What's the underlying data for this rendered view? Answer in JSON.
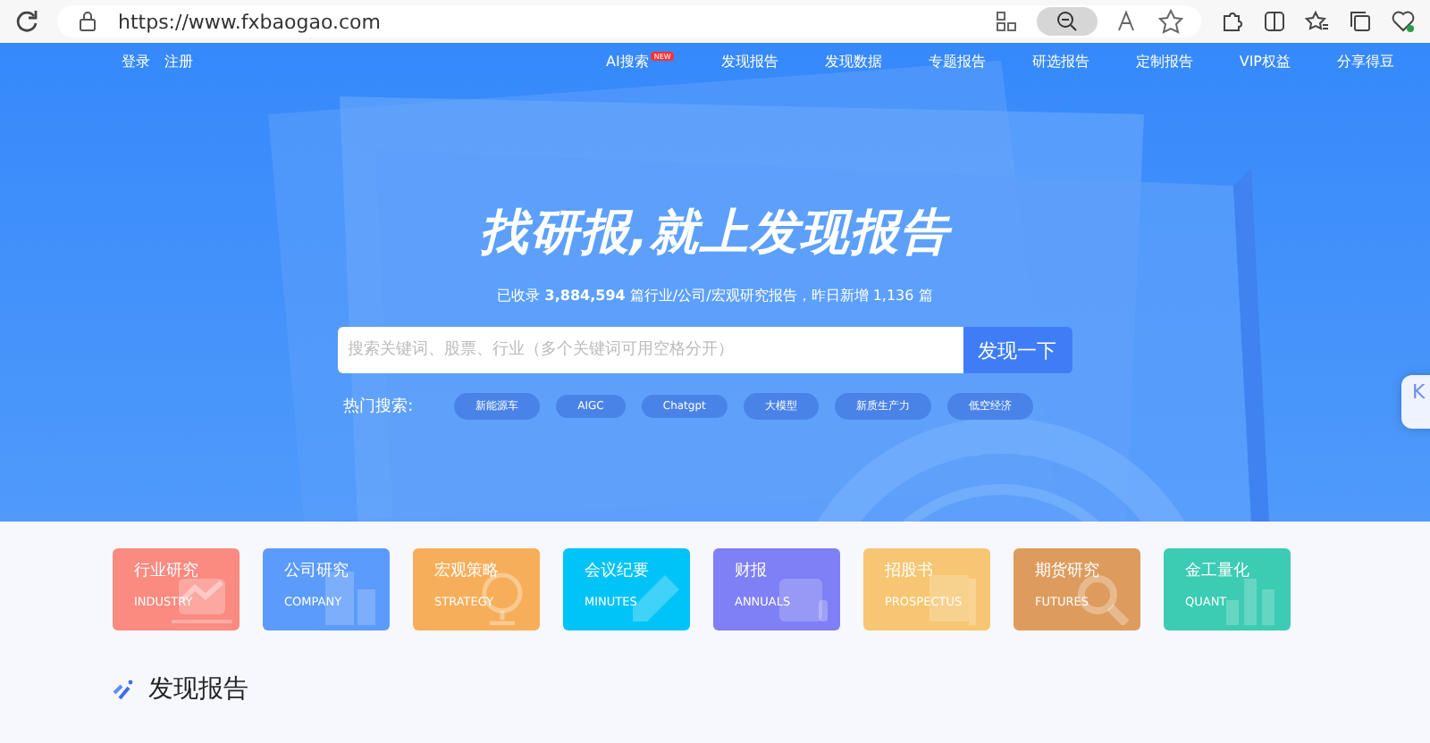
{
  "browser": {
    "url": "https://www.fxbaogao.com"
  },
  "nav": {
    "left": [
      "登录",
      "注册"
    ],
    "links": [
      {
        "label": "AI搜索",
        "badge": "NEW"
      },
      {
        "label": "发现报告"
      },
      {
        "label": "发现数据"
      },
      {
        "label": "专题报告"
      },
      {
        "label": "研选报告"
      },
      {
        "label": "定制报告"
      },
      {
        "label": "VIP权益"
      },
      {
        "label": "分享得豆"
      }
    ]
  },
  "hero": {
    "title": "找研报,就上发现报告",
    "subtitle_prefix": "已收录",
    "count": "3,884,594",
    "subtitle_middle": "篇行业/公司/宏观研究报告，昨日新增",
    "new_count": "1,136",
    "subtitle_suffix": "篇",
    "search": {
      "placeholder": "搜索关键词、股票、行业（多个关键词可用空格分开）",
      "button": "发现一下"
    },
    "hot_label": "热门搜索:",
    "hot_tags": [
      "新能源车",
      "AIGC",
      "Chatgpt",
      "大模型",
      "新质生产力",
      "低空经济"
    ]
  },
  "side_widget": {
    "label": "K"
  },
  "categories": [
    {
      "title": "行业研究",
      "subtitle": "INDUSTRY",
      "color": "#fb8a80",
      "kind": "chart"
    },
    {
      "title": "公司研究",
      "subtitle": "COMPANY",
      "color": "#5b9bfc",
      "kind": "building"
    },
    {
      "title": "宏观策略",
      "subtitle": "STRATEGY",
      "color": "#f7ae5a",
      "kind": "globe"
    },
    {
      "title": "会议纪要",
      "subtitle": "MINUTES",
      "color": "#00c3f7",
      "kind": "pencil"
    },
    {
      "title": "财报",
      "subtitle": "ANNUALS",
      "color": "#7f7ff6",
      "kind": "scroll"
    },
    {
      "title": "招股书",
      "subtitle": "PROSPECTUS",
      "color": "#f6c672",
      "kind": "book"
    },
    {
      "title": "期货研究",
      "subtitle": "FUTURES",
      "color": "#dd9c5e",
      "kind": "magnifier"
    },
    {
      "title": "金工量化",
      "subtitle": "QUANT",
      "color": "#3ccbb3",
      "kind": "bars"
    }
  ],
  "section": {
    "title": "发现报告"
  }
}
